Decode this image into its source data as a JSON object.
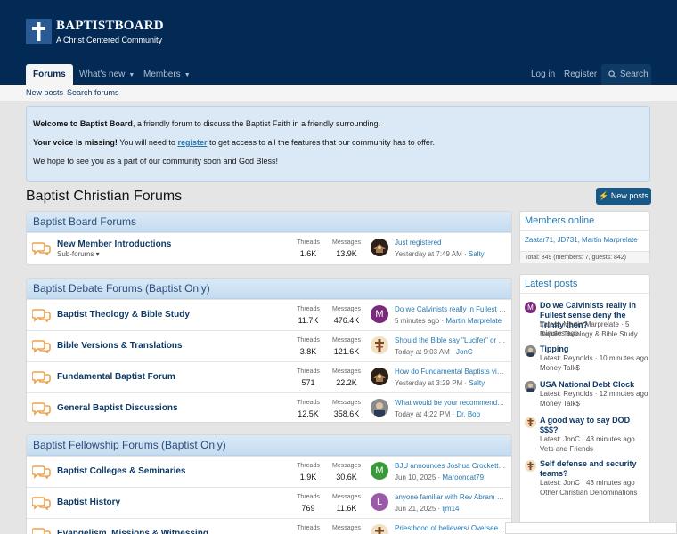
{
  "brand": {
    "name": "BAPTISTBOARD",
    "tagline": "A Christ Centered Community"
  },
  "nav": {
    "tabs": [
      {
        "label": "Forums",
        "active": true
      },
      {
        "label": "What's new",
        "active": false
      },
      {
        "label": "Members",
        "active": false
      }
    ],
    "login": "Log in",
    "register": "Register",
    "search": "Search"
  },
  "subnav": {
    "new_posts": "New posts",
    "search_forums": "Search forums"
  },
  "notice": {
    "line1_bold": "Welcome to Baptist Board",
    "line1_rest": ", a friendly forum to discuss the Baptist Faith in a friendly surrounding.",
    "line2_bold": "Your voice is missing!",
    "line2_pre": " You will need to ",
    "line2_link": "register",
    "line2_post": " to get access to all the features that our community has to offer.",
    "line3": "We hope to see you as a part of our community soon and God Bless!"
  },
  "page": {
    "title": "Baptist Christian Forums",
    "new_posts_button": "New posts"
  },
  "labels": {
    "threads": "Threads",
    "messages": "Messages",
    "sub_forums": "Sub-forums"
  },
  "categories": [
    {
      "title": "Baptist Board Forums",
      "nodes": [
        {
          "title": "New Member Introductions",
          "has_sub": true,
          "threads": "1.6K",
          "messages": "13.9K",
          "last_title": "Just registered",
          "last_time": "Yesterday at 7:49 AM",
          "last_user": "Salty",
          "avatar": "dark"
        }
      ]
    },
    {
      "title": "Baptist Debate Forums (Baptist Only)",
      "nodes": [
        {
          "title": "Baptist Theology & Bible Study",
          "has_sub": false,
          "threads": "11.7K",
          "messages": "476.4K",
          "last_title": "Do we Calvinists really in Fullest s...",
          "last_time": "5 minutes ago",
          "last_user": "Martin Marprelate",
          "avatar": "M"
        },
        {
          "title": "Bible Versions & Translations",
          "has_sub": false,
          "threads": "3.8K",
          "messages": "121.6K",
          "last_title": "Should the Bible say \"Lucifer\" or \"...",
          "last_time": "Today at 9:03 AM",
          "last_user": "JonC",
          "avatar": "cross"
        },
        {
          "title": "Fundamental Baptist Forum",
          "has_sub": false,
          "threads": "571",
          "messages": "22.2K",
          "last_title": "How do Fundamental Baptists vie...",
          "last_time": "Yesterday at 3:29 PM",
          "last_user": "Salty",
          "avatar": "dark"
        },
        {
          "title": "General Baptist Discussions",
          "has_sub": false,
          "threads": "12.5K",
          "messages": "358.6K",
          "last_title": "What would be your recommendati...",
          "last_time": "Today at 4:22 PM",
          "last_user": "Dr. Bob",
          "avatar": "photo"
        }
      ]
    },
    {
      "title": "Baptist Fellowship Forums (Baptist Only)",
      "nodes": [
        {
          "title": "Baptist Colleges & Seminaries",
          "has_sub": false,
          "threads": "1.9K",
          "messages": "30.6K",
          "last_title": "BJU announces Joshua Crockett a...",
          "last_time": "Jun 10, 2025",
          "last_user": "Marooncat79",
          "avatar": "M"
        },
        {
          "title": "Baptist History",
          "has_sub": false,
          "threads": "769",
          "messages": "11.6K",
          "last_title": "anyone familiar with Rev Abram Gi...",
          "last_time": "Jun 21, 2025",
          "last_user": "ljm14",
          "avatar": "L"
        },
        {
          "title": "Evangelism, Missions & Witnessing",
          "has_sub": false,
          "threads": "",
          "messages": "",
          "last_title": "Priesthood of believers/ Overseein...",
          "last_time": "",
          "last_user": "",
          "avatar": "cross"
        }
      ]
    }
  ],
  "members_online": {
    "title": "Members online",
    "members": "Zaatar71, JD731, Martin Marprelate",
    "total": "Total: 849 (members: 7, guests: 842)"
  },
  "latest_posts": {
    "title": "Latest posts",
    "items": [
      {
        "title": "Do we Calvinists really in Fullest sense deny the Trinity then?",
        "meta1": "Latest: Martin Marprelate · 5 minutes ago",
        "meta2": "Baptist Theology & Bible Study",
        "avatar": "M"
      },
      {
        "title": "Tipping",
        "meta1": "Latest: Reynolds · 10 minutes ago",
        "meta2": "Money Talk$",
        "avatar": "photo"
      },
      {
        "title": "USA National Debt Clock",
        "meta1": "Latest: Reynolds · 12 minutes ago",
        "meta2": "Money Talk$",
        "avatar": "photo"
      },
      {
        "title": "A good way to say DOD $$$?",
        "meta1": "Latest: JonC · 43 minutes ago",
        "meta2": "Vets and Friends",
        "avatar": "cross"
      },
      {
        "title": "Self defense and security teams?",
        "meta1": "Latest: JonC · 43 minutes ago",
        "meta2": "Other Christian Denominations",
        "avatar": "cross"
      }
    ]
  },
  "colors": {
    "header_bg": "#032a55",
    "accent": "#2577b1",
    "category_bg": "#dbe9f6",
    "forum_icon": "#f0a04b"
  }
}
